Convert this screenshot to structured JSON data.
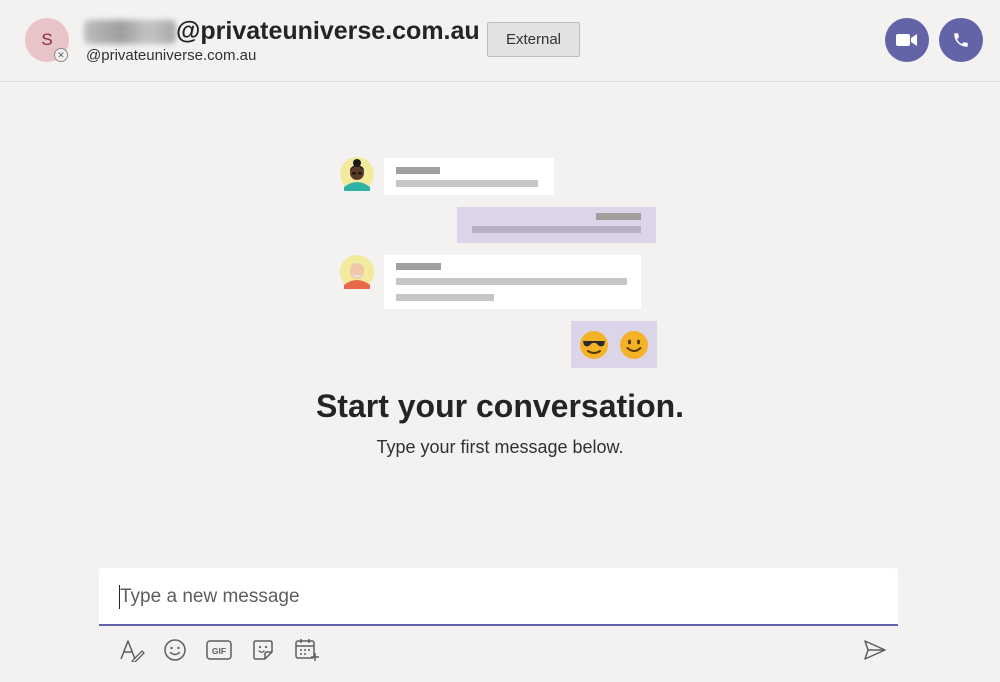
{
  "header": {
    "avatar_initial": "S",
    "title_domain": "@privateuniverse.com.au",
    "subtitle_email": "@privateuniverse.com.au",
    "external_badge": "External",
    "video_call_icon": "video-camera-icon",
    "audio_call_icon": "phone-icon"
  },
  "empty_state": {
    "title": "Start your conversation.",
    "subtitle": "Type your first message below.",
    "emojis": [
      "😎",
      "🙂"
    ]
  },
  "compose": {
    "placeholder": "Type a new message",
    "value": ""
  },
  "toolbar": {
    "icons": [
      "format-icon",
      "emoji-icon",
      "gif-icon",
      "sticker-icon",
      "schedule-meeting-icon",
      "send-icon"
    ]
  },
  "colors": {
    "accent": "#6264a7",
    "background": "#f3f2f1",
    "bubble_purple": "#dcd5ea",
    "avatar_bg": "#e8c4c8"
  }
}
